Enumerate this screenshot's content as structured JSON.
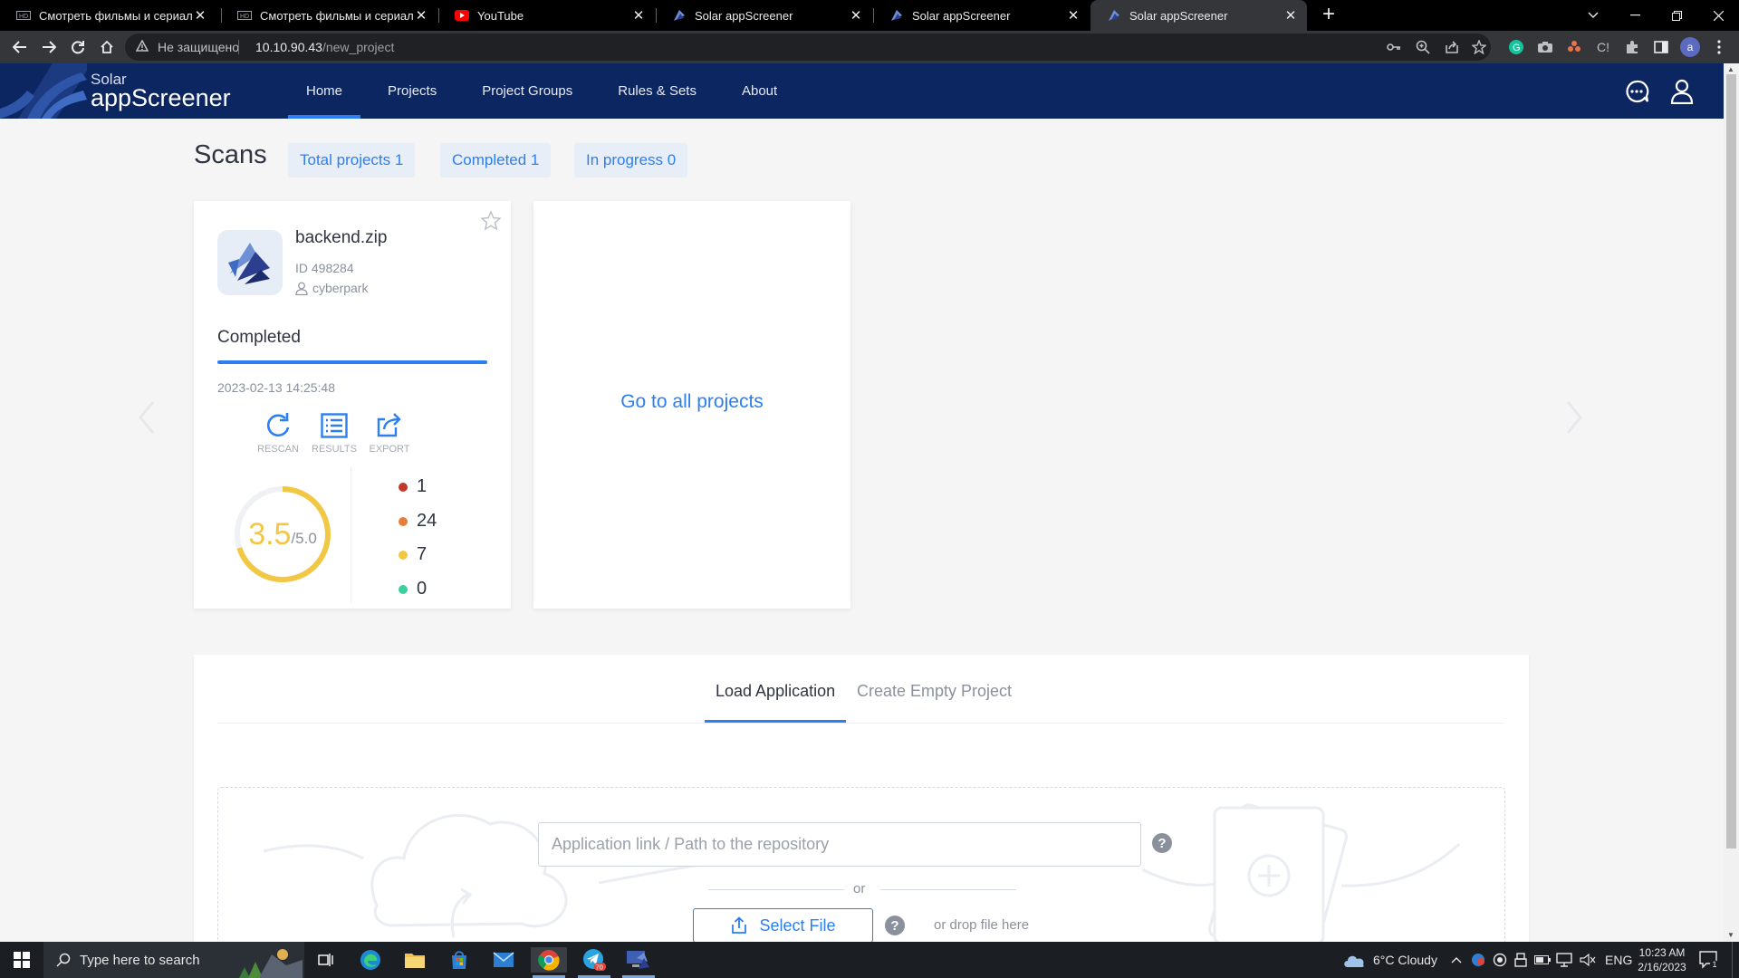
{
  "browser": {
    "tabs": [
      {
        "title": "Смотреть фильмы и сериалы онлайн",
        "icon": "hd-icon"
      },
      {
        "title": "Смотреть фильмы и сериалы онлайн",
        "icon": "hd-icon"
      },
      {
        "title": "YouTube",
        "icon": "youtube-icon"
      },
      {
        "title": "Solar appScreener",
        "icon": "solar-icon"
      },
      {
        "title": "Solar appScreener",
        "icon": "solar-icon"
      },
      {
        "title": "Solar appScreener",
        "icon": "solar-icon",
        "active": true
      }
    ],
    "address": {
      "security_label": "Не защищено",
      "host": "10.10.90.43",
      "path": "/new_project"
    }
  },
  "app": {
    "brand": {
      "line1": "Solar",
      "line2": "appScreener"
    },
    "nav": [
      "Home",
      "Projects",
      "Project Groups",
      "Rules & Sets",
      "About"
    ],
    "active_nav": "Home"
  },
  "scans": {
    "title": "Scans",
    "chips": {
      "total": "Total projects 1",
      "completed": "Completed 1",
      "in_progress": "In progress 0"
    }
  },
  "project": {
    "name": "backend.zip",
    "id": "ID 498284",
    "owner": "cyberpark",
    "status": "Completed",
    "progress": 1.0,
    "date": "2023-02-13 14:25:48",
    "actions": {
      "rescan": "RESCAN",
      "results": "RESULTS",
      "export": "EXPORT"
    },
    "rating": {
      "value": "3.5",
      "max": "/5.0",
      "fraction": 0.7
    },
    "severity": [
      {
        "level": "critical",
        "count": "1",
        "color": "#c0392b"
      },
      {
        "level": "medium",
        "count": "24",
        "color": "#e67e39"
      },
      {
        "level": "low",
        "count": "7",
        "color": "#f2c744"
      },
      {
        "level": "info",
        "count": "0",
        "color": "#3ccf9b"
      }
    ]
  },
  "all_projects_link": "Go to all projects",
  "load": {
    "tab_load": "Load Application",
    "tab_empty": "Create Empty Project",
    "repo_placeholder": "Application link / Path to the repository",
    "or": "or",
    "select_file": "Select File",
    "drop_hint": "or drop file here"
  },
  "taskbar": {
    "search_placeholder": "Type here to search",
    "weather": "6°C  Cloudy",
    "lang": "ENG",
    "time": "10:23 AM",
    "date": "2/16/2023",
    "telegram_badge": "70",
    "notifications": "1"
  },
  "colors": {
    "nav_bg": "#0c2661",
    "accent": "#2b7ff0",
    "rating": "#f2c744"
  }
}
